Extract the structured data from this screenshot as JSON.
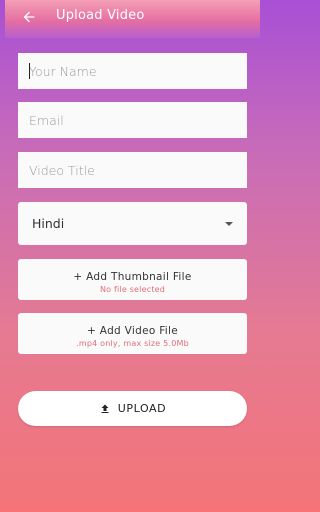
{
  "appbar": {
    "title": "Upload Video",
    "back_icon": "arrow-back-icon"
  },
  "form": {
    "name_placeholder": "Your Name",
    "email_placeholder": "Email",
    "title_placeholder": "Video Title",
    "language_value": "Hindi",
    "thumbnail": {
      "label": "+ Add Thumbnail File",
      "status": "No file selected"
    },
    "video": {
      "label": "+ Add Video File",
      "hint": ".mp4 only, max size 5.0Mb"
    },
    "upload_label": "UPLOAD"
  },
  "colors": {
    "gradient_top": "#a84fd6",
    "gradient_bottom": "#f47478",
    "hint_text": "#e06f7a"
  }
}
